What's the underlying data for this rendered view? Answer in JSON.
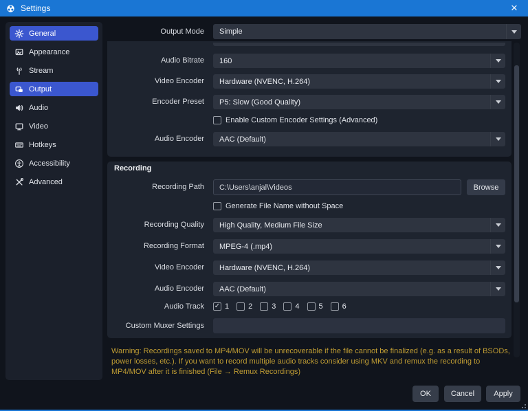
{
  "titlebar": {
    "title": "Settings",
    "close_glyph": "✕"
  },
  "sidebar": {
    "items": [
      {
        "label": "General",
        "icon": "gear-icon",
        "selected": true
      },
      {
        "label": "Appearance",
        "icon": "appearance-icon",
        "selected": false
      },
      {
        "label": "Stream",
        "icon": "stream-icon",
        "selected": false
      },
      {
        "label": "Output",
        "icon": "output-icon",
        "selected": true
      },
      {
        "label": "Audio",
        "icon": "audio-icon",
        "selected": false
      },
      {
        "label": "Video",
        "icon": "video-icon",
        "selected": false
      },
      {
        "label": "Hotkeys",
        "icon": "hotkeys-icon",
        "selected": false
      },
      {
        "label": "Accessibility",
        "icon": "accessibility-icon",
        "selected": false
      },
      {
        "label": "Advanced",
        "icon": "advanced-icon",
        "selected": false
      }
    ]
  },
  "main": {
    "output_mode": {
      "label": "Output Mode",
      "value": "Simple"
    },
    "streaming": {
      "audio_bitrate": {
        "label": "Audio Bitrate",
        "value": "160"
      },
      "video_encoder": {
        "label": "Video Encoder",
        "value": "Hardware (NVENC, H.264)"
      },
      "encoder_preset": {
        "label": "Encoder Preset",
        "value": "P5: Slow (Good Quality)"
      },
      "custom_encoder": {
        "label": "Enable Custom Encoder Settings (Advanced)",
        "checked": false
      },
      "audio_encoder": {
        "label": "Audio Encoder",
        "value": "AAC (Default)"
      }
    },
    "recording": {
      "title": "Recording",
      "path": {
        "label": "Recording Path",
        "value": "C:\\Users\\anjal\\Videos",
        "browse_label": "Browse"
      },
      "no_space": {
        "label": "Generate File Name without Space",
        "checked": false
      },
      "quality": {
        "label": "Recording Quality",
        "value": "High Quality, Medium File Size"
      },
      "format": {
        "label": "Recording Format",
        "value": "MPEG-4 (.mp4)"
      },
      "video_encoder": {
        "label": "Video Encoder",
        "value": "Hardware (NVENC, H.264)"
      },
      "audio_encoder": {
        "label": "Audio Encoder",
        "value": "AAC (Default)"
      },
      "audio_track": {
        "label": "Audio Track",
        "tracks": [
          {
            "label": "1",
            "checked": true
          },
          {
            "label": "2",
            "checked": false
          },
          {
            "label": "3",
            "checked": false
          },
          {
            "label": "4",
            "checked": false
          },
          {
            "label": "5",
            "checked": false
          },
          {
            "label": "6",
            "checked": false
          }
        ]
      },
      "muxer": {
        "label": "Custom Muxer Settings",
        "value": ""
      }
    },
    "warning": "Warning: Recordings saved to MP4/MOV will be unrecoverable if the file cannot be finalized (e.g. as a result of BSODs, power losses, etc.). If you want to record multiple audio tracks consider using MKV and remux the recording to MP4/MOV after it is finished (File → Remux Recordings)",
    "buttons": {
      "ok": "OK",
      "cancel": "Cancel",
      "apply": "Apply"
    }
  },
  "icons": {
    "check": "✓"
  },
  "colors": {
    "titlebar_blue": "#1a76d4",
    "accent_blue": "#3b57cf",
    "warning_text": "#bf9c33"
  }
}
